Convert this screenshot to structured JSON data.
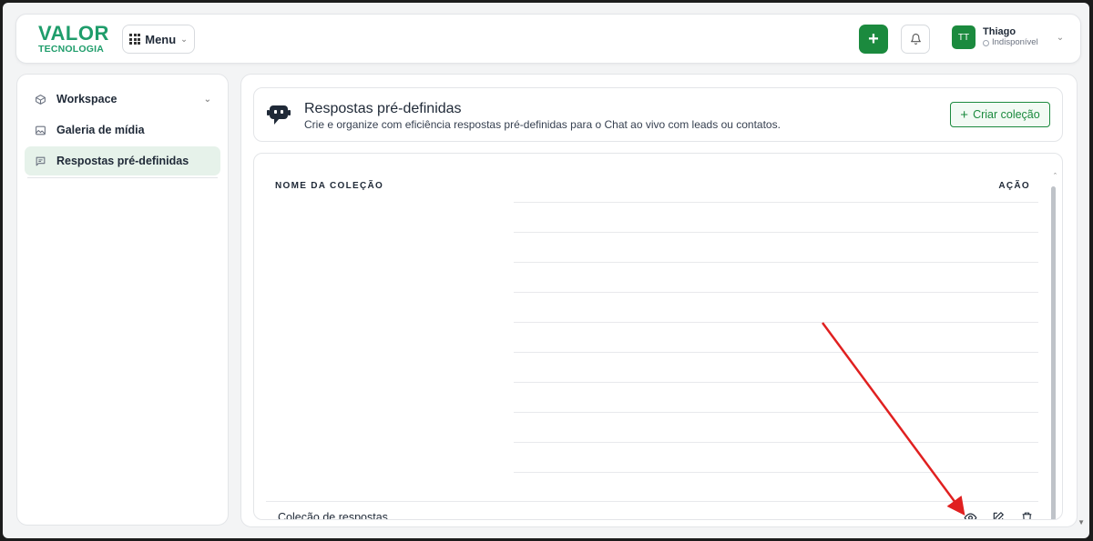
{
  "header": {
    "logo_main": "VALOR",
    "logo_sub": "TECNOLOGIA",
    "menu_label": "Menu",
    "add_icon": "plus-icon",
    "bell_icon": "bell-icon",
    "user": {
      "initials": "TT",
      "name": "Thiago",
      "status": "Indisponível"
    }
  },
  "sidebar": {
    "items": [
      {
        "label": "Workspace",
        "icon": "box-icon",
        "expandable": true
      },
      {
        "label": "Galeria de mídia",
        "icon": "image-icon"
      },
      {
        "label": "Respostas pré-definidas",
        "icon": "message-icon",
        "active": true
      }
    ]
  },
  "page": {
    "title": "Respostas pré-definidas",
    "description": "Crie e organize com eficiência respostas pré-definidas para o Chat ao vivo com leads ou contatos.",
    "create_button": "Criar coleção",
    "table": {
      "columns": [
        "NOME DA COLEÇÃO",
        "AÇÃO"
      ],
      "rows": [
        {
          "name": "Coleção de respostas",
          "actions": [
            "eye-icon",
            "edit-icon",
            "trash-icon"
          ]
        }
      ]
    }
  },
  "colors": {
    "brand": "#1f9d6b",
    "primary": "#1b8a3e",
    "active_bg": "#e6f2ea",
    "annotation_arrow": "#e02020"
  }
}
